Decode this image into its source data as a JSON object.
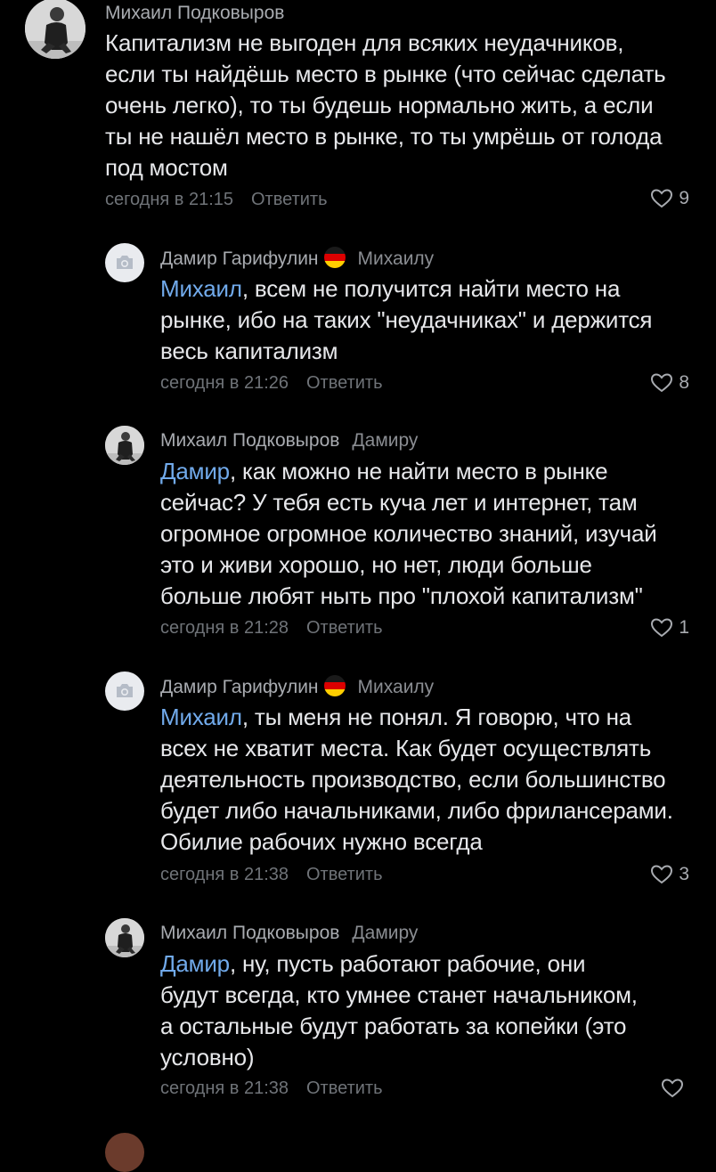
{
  "colors": {
    "background": "#000000",
    "text": "#e6e7ea",
    "author": "#a8abb0",
    "meta": "#6f7378",
    "mention": "#71aaeb"
  },
  "comments": [
    {
      "author": "Михаил Подковыров",
      "reply_to": "",
      "mention": "",
      "text_lines": [
        "Капитализм не выгоден для всяких неудачников,",
        "если ты найдёшь место в рынке (что сейчас сделать",
        "очень легко), то ты будешь нормально жить, а если",
        "ты не нашёл место в рынке, то ты умрёшь от голода",
        "под мостом"
      ],
      "time": "сегодня в 21:15",
      "reply_label": "Ответить",
      "likes": "9",
      "avatar": "photo-avatar"
    },
    {
      "author": "Дамир Гарифулин",
      "reply_to": "Михаилу",
      "mention": "Михаил",
      "text_lines": [
        ", всем не получится найти место на",
        "рынке, ибо на таких \"неудачниках\" и держится",
        "весь капитализм"
      ],
      "time": "сегодня в 21:26",
      "reply_label": "Ответить",
      "likes": "8",
      "avatar": "camera-avatar"
    },
    {
      "author": "Михаил Подковыров",
      "reply_to": "Дамиру",
      "mention": "Дамир",
      "text_lines": [
        ", как можно не найти место в рынке",
        "сейчас? У тебя есть куча лет и интернет, там",
        "огромное огромное количество знаний, изучай",
        "это и живи хорошо, но нет, люди больше",
        "больше любят ныть про \"плохой капитализм\""
      ],
      "time": "сегодня в 21:28",
      "reply_label": "Ответить",
      "likes": "1",
      "avatar": "photo-avatar"
    },
    {
      "author": "Дамир Гарифулин",
      "reply_to": "Михаилу",
      "mention": "Михаил",
      "text_lines": [
        ", ты меня не понял. Я говорю, что на",
        "всех не хватит места. Как будет осуществлять",
        "деятельность производство, если большинство",
        "будет либо начальниками, либо фрилансерами.",
        "Обилие рабочих нужно всегда"
      ],
      "time": "сегодня в 21:38",
      "reply_label": "Ответить",
      "likes": "3",
      "avatar": "camera-avatar"
    },
    {
      "author": "Михаил Подковыров",
      "reply_to": "Дамиру",
      "mention": "Дамир",
      "text_lines": [
        ", ну, пусть работают рабочие, они",
        "будут всегда, кто умнее станет начальником,",
        "а остальные будут работать за копейки (это",
        "условно)"
      ],
      "time": "сегодня в 21:38",
      "reply_label": "Ответить",
      "likes": "",
      "avatar": "photo-avatar"
    }
  ]
}
